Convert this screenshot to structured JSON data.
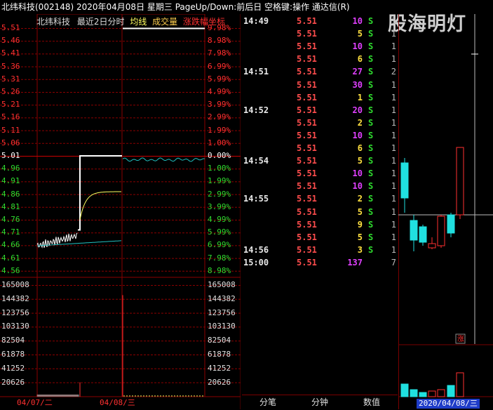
{
  "title_bar": "北纬科技(002148)  2020年04月08日 星期三 PageUp/Down:前后日 空格键:操作 通达信(R)",
  "watermark": "股海明灯",
  "chart": {
    "legend": {
      "name": "北纬科技",
      "range": "最近2日分时",
      "avg_label": "均线",
      "vol_label": "成交量",
      "coord_label": "涨跌幅坐标"
    },
    "price_labels": [
      "5.51",
      "5.46",
      "5.41",
      "5.36",
      "5.31",
      "5.26",
      "5.21",
      "5.16",
      "5.11",
      "5.06",
      "5.01",
      "4.96",
      "4.91",
      "4.86",
      "4.81",
      "4.76",
      "4.71",
      "4.66",
      "4.61",
      "4.56"
    ],
    "pct_labels": [
      "9.98%",
      "8.98%",
      "7.98%",
      "6.99%",
      "5.99%",
      "4.99%",
      "3.99%",
      "2.99%",
      "1.99%",
      "1.00%",
      "0.00%",
      "1.00%",
      "1.99%",
      "2.99%",
      "3.99%",
      "4.99%",
      "5.99%",
      "6.99%",
      "7.98%",
      "8.98%"
    ],
    "vol_labels": [
      "165008",
      "144382",
      "123756",
      "103130",
      "82504",
      "61878",
      "41252",
      "20626"
    ],
    "date_labels": [
      "04/07/二",
      "04/08/三"
    ],
    "colors": {
      "up": "#ff3030",
      "down": "#20d0d0",
      "grid": "#8b0000",
      "price_line": "#ffffff",
      "avg_line": "#ffff60"
    }
  },
  "ticks": [
    {
      "time": "14:49",
      "price": "5.51",
      "vol": "10",
      "vol_color": "purple",
      "dir": "S",
      "cnt": "1"
    },
    {
      "time": "",
      "price": "5.51",
      "vol": "5",
      "vol_color": "yellow",
      "dir": "S",
      "cnt": "1"
    },
    {
      "time": "",
      "price": "5.51",
      "vol": "10",
      "vol_color": "purple",
      "dir": "S",
      "cnt": "1"
    },
    {
      "time": "",
      "price": "5.51",
      "vol": "6",
      "vol_color": "yellow",
      "dir": "S",
      "cnt": "1"
    },
    {
      "time": "14:51",
      "price": "5.51",
      "vol": "27",
      "vol_color": "purple",
      "dir": "S",
      "cnt": "2"
    },
    {
      "time": "",
      "price": "5.51",
      "vol": "30",
      "vol_color": "purple",
      "dir": "S",
      "cnt": "1"
    },
    {
      "time": "",
      "price": "5.51",
      "vol": "1",
      "vol_color": "yellow",
      "dir": "S",
      "cnt": "1"
    },
    {
      "time": "14:52",
      "price": "5.51",
      "vol": "20",
      "vol_color": "purple",
      "dir": "S",
      "cnt": "1"
    },
    {
      "time": "",
      "price": "5.51",
      "vol": "2",
      "vol_color": "yellow",
      "dir": "S",
      "cnt": "1"
    },
    {
      "time": "",
      "price": "5.51",
      "vol": "10",
      "vol_color": "purple",
      "dir": "S",
      "cnt": "1"
    },
    {
      "time": "",
      "price": "5.51",
      "vol": "6",
      "vol_color": "yellow",
      "dir": "S",
      "cnt": "1"
    },
    {
      "time": "14:54",
      "price": "5.51",
      "vol": "5",
      "vol_color": "yellow",
      "dir": "S",
      "cnt": "1"
    },
    {
      "time": "",
      "price": "5.51",
      "vol": "10",
      "vol_color": "purple",
      "dir": "S",
      "cnt": "1"
    },
    {
      "time": "",
      "price": "5.51",
      "vol": "10",
      "vol_color": "purple",
      "dir": "S",
      "cnt": "1"
    },
    {
      "time": "14:55",
      "price": "5.51",
      "vol": "2",
      "vol_color": "yellow",
      "dir": "S",
      "cnt": "1"
    },
    {
      "time": "",
      "price": "5.51",
      "vol": "5",
      "vol_color": "yellow",
      "dir": "S",
      "cnt": "1"
    },
    {
      "time": "",
      "price": "5.51",
      "vol": "9",
      "vol_color": "yellow",
      "dir": "S",
      "cnt": "1"
    },
    {
      "time": "",
      "price": "5.51",
      "vol": "5",
      "vol_color": "yellow",
      "dir": "S",
      "cnt": "1"
    },
    {
      "time": "14:56",
      "price": "5.51",
      "vol": "3",
      "vol_color": "yellow",
      "dir": "S",
      "cnt": "1"
    },
    {
      "time": "15:00",
      "price": "5.51",
      "vol": "137",
      "vol_color": "purple",
      "dir": "",
      "cnt": "7"
    }
  ],
  "bottom_tabs": [
    "分笔",
    "分钟",
    "数值"
  ],
  "kline_date": "2020/04/08/三",
  "kline_marker": "涨"
}
